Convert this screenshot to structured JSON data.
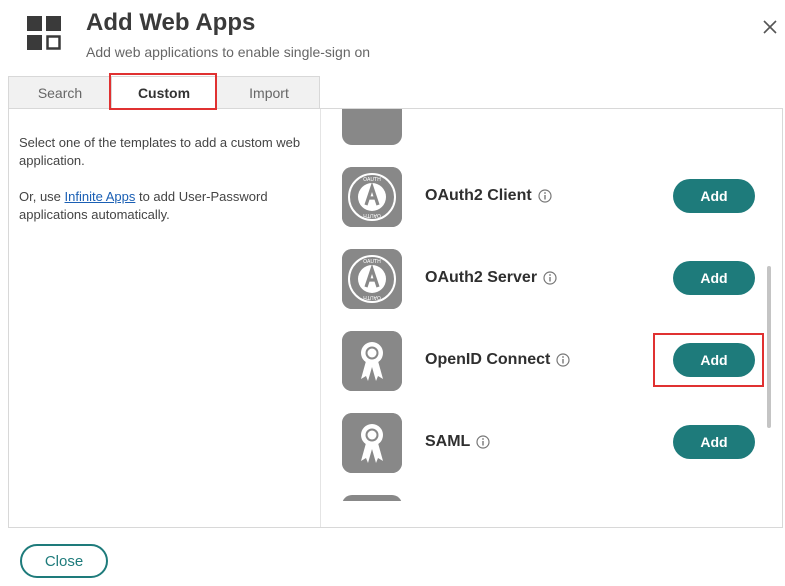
{
  "header": {
    "title": "Add Web Apps",
    "subtitle": "Add web applications to enable single-sign on",
    "icon": "apps-grid-icon"
  },
  "tabs": [
    {
      "label": "Search",
      "selected": false
    },
    {
      "label": "Custom",
      "selected": true
    },
    {
      "label": "Import",
      "selected": false
    }
  ],
  "left_pane": {
    "intro": "Select one of the templates to add a custom web application.",
    "or_use": "Or, use ",
    "link_text": "Infinite Apps",
    "suffix": " to add User-Password applications automatically."
  },
  "apps": [
    {
      "name": "OAuth2 Client",
      "logo": "oauth-icon",
      "add_label": "Add"
    },
    {
      "name": "OAuth2 Server",
      "logo": "oauth-icon",
      "add_label": "Add"
    },
    {
      "name": "OpenID Connect",
      "logo": "ribbon-award-icon",
      "add_label": "Add"
    },
    {
      "name": "SAML",
      "logo": "ribbon-award-icon",
      "add_label": "Add"
    }
  ],
  "footer": {
    "close_label": "Close"
  },
  "colors": {
    "accent": "#1e7b7b",
    "highlight": "#e03131",
    "logo_bg": "#888888"
  }
}
